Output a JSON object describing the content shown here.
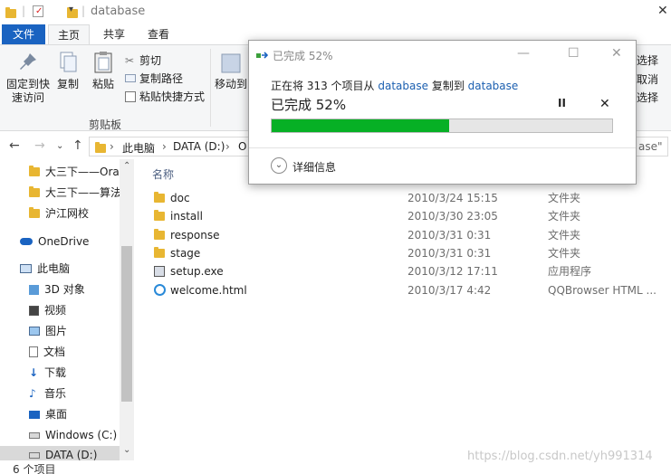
{
  "window": {
    "title": "database"
  },
  "ribbon": {
    "tabs": [
      "文件",
      "主页",
      "共享",
      "查看"
    ],
    "pin_label_1": "固定到快",
    "pin_label_2": "速访问",
    "copy_label": "复制",
    "paste_label": "粘贴",
    "cut_label": "剪切",
    "copy_path_label": "复制路径",
    "paste_shortcut_label": "粘贴快捷方式",
    "move_label": "移动到",
    "group_label": "剪贴板",
    "right_1": "选择",
    "right_2": "取消",
    "right_3": "选择"
  },
  "address": {
    "crumbs": [
      "此电脑",
      "DATA (D:)",
      "O"
    ],
    "search_tail": "ase\""
  },
  "nav": {
    "items": [
      "大三下——Orac",
      "大三下——算法",
      "沪江网校",
      "OneDrive",
      "此电脑",
      "3D 对象",
      "视频",
      "图片",
      "文档",
      "下载",
      "音乐",
      "桌面",
      "Windows (C:)",
      "DATA (D:)"
    ]
  },
  "list": {
    "header_name": "名称",
    "rows": [
      {
        "name": "doc",
        "date": "2010/3/24 15:15",
        "type": "文件夹",
        "icon": "folder-icon"
      },
      {
        "name": "install",
        "date": "2010/3/30 23:05",
        "type": "文件夹",
        "icon": "folder-icon"
      },
      {
        "name": "response",
        "date": "2010/3/31 0:31",
        "type": "文件夹",
        "icon": "folder-icon"
      },
      {
        "name": "stage",
        "date": "2010/3/31 0:31",
        "type": "文件夹",
        "icon": "folder-icon"
      },
      {
        "name": "setup.exe",
        "date": "2010/3/12 17:11",
        "type": "应用程序",
        "icon": "exe-icon"
      },
      {
        "name": "welcome.html",
        "date": "2010/3/17 4:42",
        "type": "QQBrowser HTML ...",
        "icon": "browser-icon"
      }
    ]
  },
  "status": {
    "count": "6 个项目"
  },
  "watermark": "https://blog.csdn.net/yh991314",
  "dialog": {
    "title": "已完成 52%",
    "line_prefix": "正在将 313 个项目从 ",
    "source": "database",
    "line_mid": " 复制到 ",
    "dest": "database",
    "percent_text": "已完成 52%",
    "progress": 0.52,
    "details_label": "详细信息",
    "pause_glyph": "II",
    "cancel_glyph": "✕"
  },
  "colors": {
    "accent": "#1a63c1",
    "progress": "#06b025",
    "link": "#1b5fb0"
  }
}
